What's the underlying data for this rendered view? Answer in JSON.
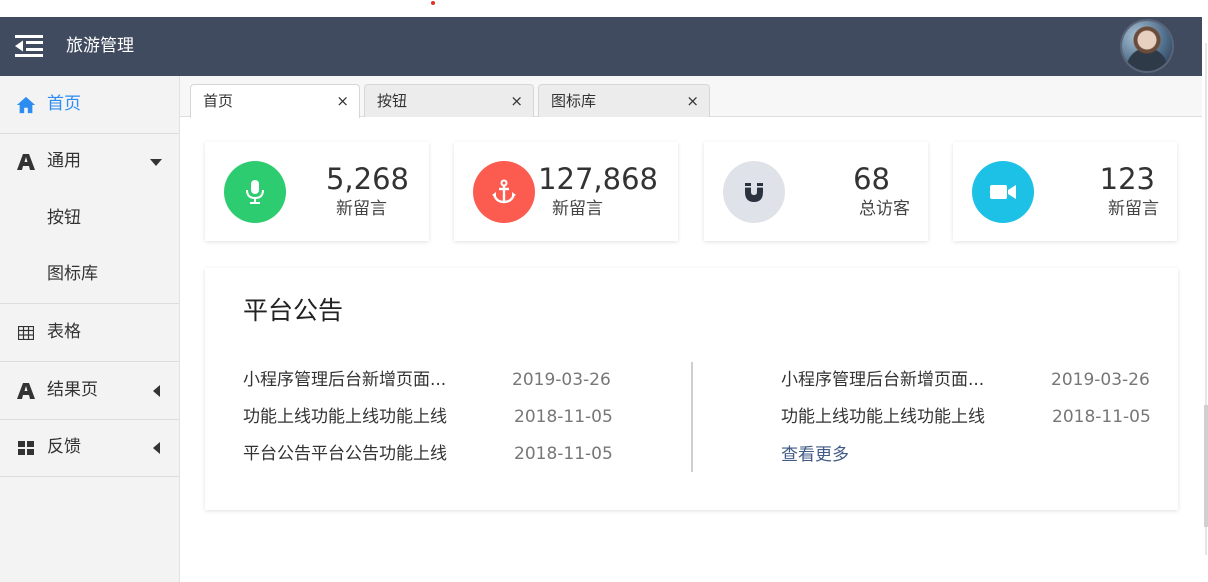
{
  "app": {
    "title": "旅游管理"
  },
  "header": {
    "menu_icon": "menu-collapse-icon",
    "avatar_icon": "user-avatar"
  },
  "sidebar": {
    "items": [
      {
        "label": "首页",
        "icon": "home-icon",
        "active": true
      },
      {
        "label": "通用",
        "icon": "font-icon",
        "expanded": true,
        "children": [
          {
            "label": "按钮"
          },
          {
            "label": "图标库"
          }
        ]
      },
      {
        "label": "表格",
        "icon": "table-icon"
      },
      {
        "label": "结果页",
        "icon": "font-icon"
      },
      {
        "label": "反馈",
        "icon": "grid-icon"
      }
    ]
  },
  "tabs": [
    {
      "label": "首页",
      "close": "×",
      "active": true
    },
    {
      "label": "按钮",
      "close": "×"
    },
    {
      "label": "图标库",
      "close": "×"
    }
  ],
  "stats": [
    {
      "value": "5,268",
      "label": "新留言",
      "icon": "microphone-icon",
      "color": "#2ecc71"
    },
    {
      "value": "127,868",
      "label": "新留言",
      "icon": "anchor-icon",
      "color": "#fc5b4f"
    },
    {
      "value": "68",
      "label": "总访客",
      "icon": "magnet-icon",
      "color": "#dfe2e8"
    },
    {
      "value": "123",
      "label": "新留言",
      "icon": "video-camera-icon",
      "color": "#1ec1e6"
    }
  ],
  "notice": {
    "title": "平台公告",
    "left": [
      {
        "text": "小程序管理后台新增页面...",
        "date": "2019-03-26"
      },
      {
        "text": "功能上线功能上线功能上线",
        "date": "2018-11-05"
      },
      {
        "text": "平台公告平台公告功能上线",
        "date": "2018-11-05"
      }
    ],
    "right": [
      {
        "text": "小程序管理后台新增页面...",
        "date": "2019-03-26"
      },
      {
        "text": "功能上线功能上线功能上线",
        "date": "2018-11-05"
      }
    ],
    "more": "查看更多"
  }
}
